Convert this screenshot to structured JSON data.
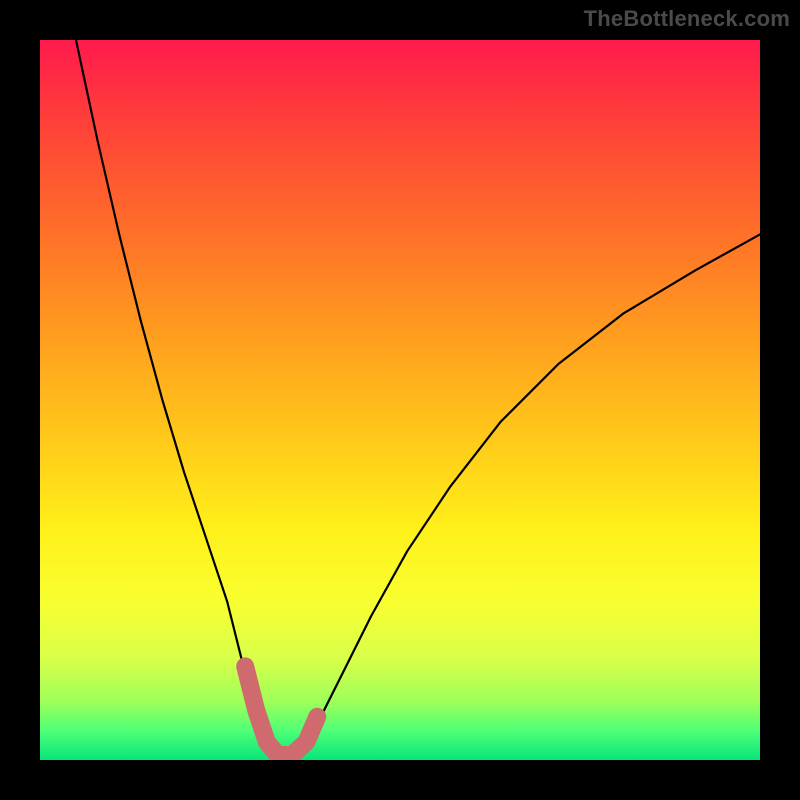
{
  "watermark": "TheBottleneck.com",
  "chart_data": {
    "type": "line",
    "title": "",
    "xlabel": "",
    "ylabel": "",
    "xlim": [
      0,
      100
    ],
    "ylim": [
      0,
      100
    ],
    "grid": false,
    "legend": false,
    "series": [
      {
        "name": "bottleneck-curve",
        "x": [
          5,
          8,
          11,
          14,
          17,
          20,
          23,
          26,
          28,
          30,
          31.5,
          33,
          35,
          37,
          39,
          42,
          46,
          51,
          57,
          64,
          72,
          81,
          91,
          100
        ],
        "y": [
          100,
          86,
          73,
          61,
          50,
          40,
          31,
          22,
          14,
          8,
          3,
          0.5,
          0.5,
          2,
          6,
          12,
          20,
          29,
          38,
          47,
          55,
          62,
          68,
          73
        ]
      }
    ],
    "highlight_segment": {
      "name": "optimal-region",
      "color": "#cf6a6f",
      "x": [
        28.5,
        30,
        31.5,
        33,
        35,
        37,
        38.5
      ],
      "y": [
        13,
        7,
        2.5,
        0.7,
        0.7,
        2.5,
        6
      ]
    },
    "gradient_stops": [
      {
        "pos": 0.0,
        "color": "#ff1a4d"
      },
      {
        "pos": 0.55,
        "color": "#ffc81a"
      },
      {
        "pos": 0.8,
        "color": "#f8ff30"
      },
      {
        "pos": 1.0,
        "color": "#08e47a"
      }
    ]
  }
}
